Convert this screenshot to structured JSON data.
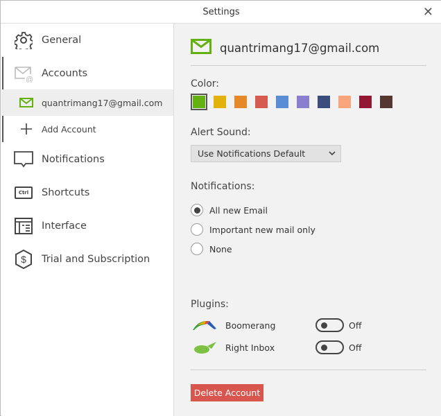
{
  "window": {
    "title": "Settings",
    "close": "✕"
  },
  "sidebar": {
    "items": [
      {
        "label": "General",
        "icon": "gear-icon"
      },
      {
        "label": "Accounts",
        "icon": "mail-at-icon"
      },
      {
        "label": "quantrimang17@gmail.com",
        "icon": "mail-icon"
      },
      {
        "label": "Add Account",
        "icon": "plus-icon"
      },
      {
        "label": "Notifications",
        "icon": "speech-bubble-icon"
      },
      {
        "label": "Shortcuts",
        "icon": "ctrl-key-icon",
        "icon_text": "Ctrl"
      },
      {
        "label": "Interface",
        "icon": "layout-icon"
      },
      {
        "label": "Trial and Subscription",
        "icon": "dollar-hexagon-icon"
      }
    ]
  },
  "account": {
    "email": "quantrimang17@gmail.com",
    "accent": "#63b110"
  },
  "color": {
    "label": "Color:",
    "swatches": [
      "#63b110",
      "#e2b10a",
      "#e5882a",
      "#d55a4f",
      "#5b8cd6",
      "#8a7fcf",
      "#3a4d7d",
      "#f9a57c",
      "#931834",
      "#563630"
    ],
    "selected": 0
  },
  "alert": {
    "label": "Alert Sound:",
    "value": "Use Notifications Default"
  },
  "notifications": {
    "label": "Notifications:",
    "options": [
      "All new Email",
      "Important new mail only",
      "None"
    ],
    "selected": 0
  },
  "plugins": {
    "label": "Plugins:",
    "items": [
      {
        "name": "Boomerang",
        "state": "Off"
      },
      {
        "name": "Right Inbox",
        "state": "Off"
      }
    ]
  },
  "delete_label": "Delete Account"
}
